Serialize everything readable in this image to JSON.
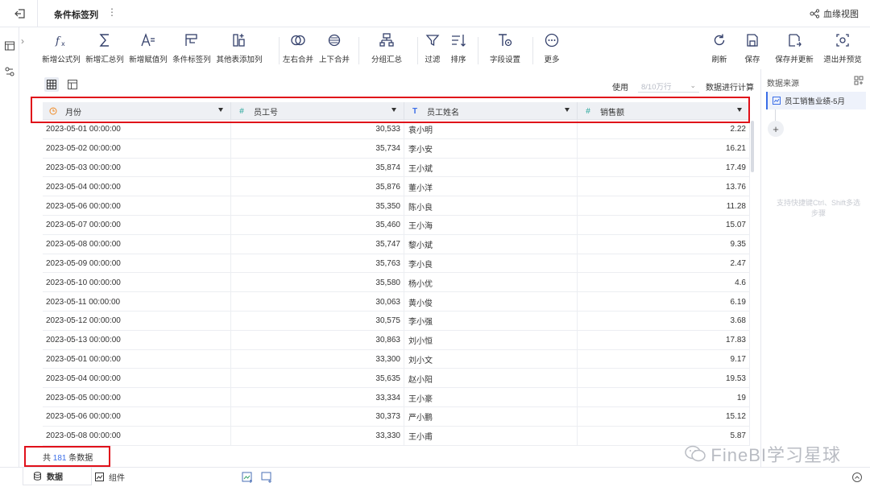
{
  "topbar": {
    "title": "条件标签列",
    "more": "⋮",
    "lineage_label": "血缘视图"
  },
  "toolbar": {
    "items": [
      {
        "label": "新增公式列",
        "icon": "fx-icon"
      },
      {
        "label": "新增汇总列",
        "icon": "sigma-icon"
      },
      {
        "label": "新增赋值列",
        "icon": "assign-icon"
      },
      {
        "label": "条件标签列",
        "icon": "condition-tag-icon"
      },
      {
        "label": "其他表添加列",
        "icon": "add-column-icon"
      },
      {
        "label": "左右合并",
        "icon": "merge-horizontal-icon"
      },
      {
        "label": "上下合并",
        "icon": "merge-vertical-icon"
      },
      {
        "label": "分组汇总",
        "icon": "group-summary-icon"
      },
      {
        "label": "过滤",
        "icon": "filter-icon"
      },
      {
        "label": "排序",
        "icon": "sort-icon"
      },
      {
        "label": "字段设置",
        "icon": "field-settings-icon"
      },
      {
        "label": "更多",
        "icon": "more-icon"
      }
    ],
    "right_items": [
      {
        "label": "刷新",
        "icon": "refresh-icon"
      },
      {
        "label": "保存",
        "icon": "save-icon"
      },
      {
        "label": "保存并更新",
        "icon": "save-update-icon"
      },
      {
        "label": "退出并预览",
        "icon": "exit-preview-icon"
      }
    ]
  },
  "usage": {
    "use_label": "使用",
    "select_value": "8/10万行",
    "suffix": "数据进行计算"
  },
  "table": {
    "columns": [
      {
        "name": "月份",
        "type": "date",
        "icon": "clock-icon"
      },
      {
        "name": "员工号",
        "type": "number",
        "icon": "hash-icon"
      },
      {
        "name": "员工姓名",
        "type": "text",
        "icon": "text-type-icon"
      },
      {
        "name": "销售额",
        "type": "number",
        "icon": "hash-icon"
      }
    ],
    "rows": [
      [
        "2023-05-01 00:00:00",
        "30,533",
        "袁小明",
        "2.22"
      ],
      [
        "2023-05-02 00:00:00",
        "35,734",
        "李小安",
        "16.21"
      ],
      [
        "2023-05-03 00:00:00",
        "35,874",
        "王小斌",
        "17.49"
      ],
      [
        "2023-05-04 00:00:00",
        "35,876",
        "董小洋",
        "13.76"
      ],
      [
        "2023-05-06 00:00:00",
        "35,350",
        "陈小良",
        "11.28"
      ],
      [
        "2023-05-07 00:00:00",
        "35,460",
        "王小海",
        "15.07"
      ],
      [
        "2023-05-08 00:00:00",
        "35,747",
        "黎小斌",
        "9.35"
      ],
      [
        "2023-05-09 00:00:00",
        "35,763",
        "李小良",
        "2.47"
      ],
      [
        "2023-05-10 00:00:00",
        "35,580",
        "杨小优",
        "4.6"
      ],
      [
        "2023-05-11 00:00:00",
        "30,063",
        "黄小俊",
        "6.19"
      ],
      [
        "2023-05-12 00:00:00",
        "30,575",
        "李小强",
        "3.68"
      ],
      [
        "2023-05-13 00:00:00",
        "30,863",
        "刘小恒",
        "17.83"
      ],
      [
        "2023-05-01 00:00:00",
        "33,300",
        "刘小文",
        "9.17"
      ],
      [
        "2023-05-04 00:00:00",
        "35,635",
        "赵小阳",
        "19.53"
      ],
      [
        "2023-05-05 00:00:00",
        "33,334",
        "王小豪",
        "19"
      ],
      [
        "2023-05-06 00:00:00",
        "30,373",
        "严小鹏",
        "15.12"
      ],
      [
        "2023-05-08 00:00:00",
        "33,330",
        "王小甫",
        "5.87"
      ]
    ]
  },
  "footer": {
    "total_prefix": "共",
    "total_count": "181",
    "total_suffix": "条数据"
  },
  "right_panel": {
    "title": "数据来源",
    "source_item": "员工销售业绩-5月",
    "add": "+",
    "hint": "支持快捷键Ctrl、Shift多选步骤"
  },
  "bottom_tabs": [
    {
      "label": "数据",
      "icon": "database-icon"
    },
    {
      "label": "组件",
      "icon": "chart-component-icon"
    }
  ],
  "watermark": "FineBI学习星球",
  "colors": {
    "accent": "#3b6ee8",
    "highlight": "#e0101a",
    "header_bg": "#eef0f4"
  }
}
